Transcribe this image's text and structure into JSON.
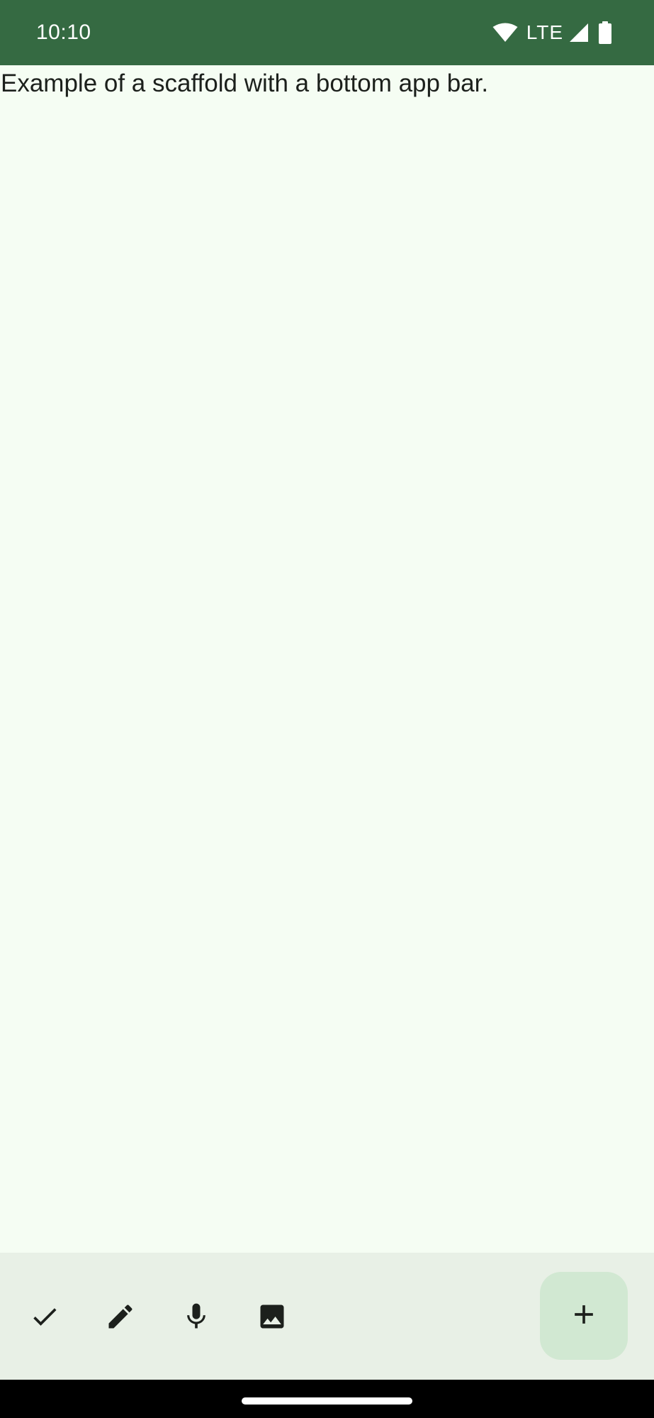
{
  "status_bar": {
    "time": "10:10",
    "network": "LTE",
    "background": "#356a42"
  },
  "content": {
    "text": "Example of a scaffold with a bottom app bar."
  },
  "bottom_bar": {
    "actions": [
      {
        "icon": "check-icon"
      },
      {
        "icon": "pencil-icon"
      },
      {
        "icon": "microphone-icon"
      },
      {
        "icon": "image-icon"
      }
    ],
    "fab_icon": "plus-icon",
    "fab_color": "#d1e8d2",
    "background": "#e8f0e6"
  },
  "colors": {
    "surface": "#f5fdf3",
    "on_surface": "#1c201c"
  }
}
